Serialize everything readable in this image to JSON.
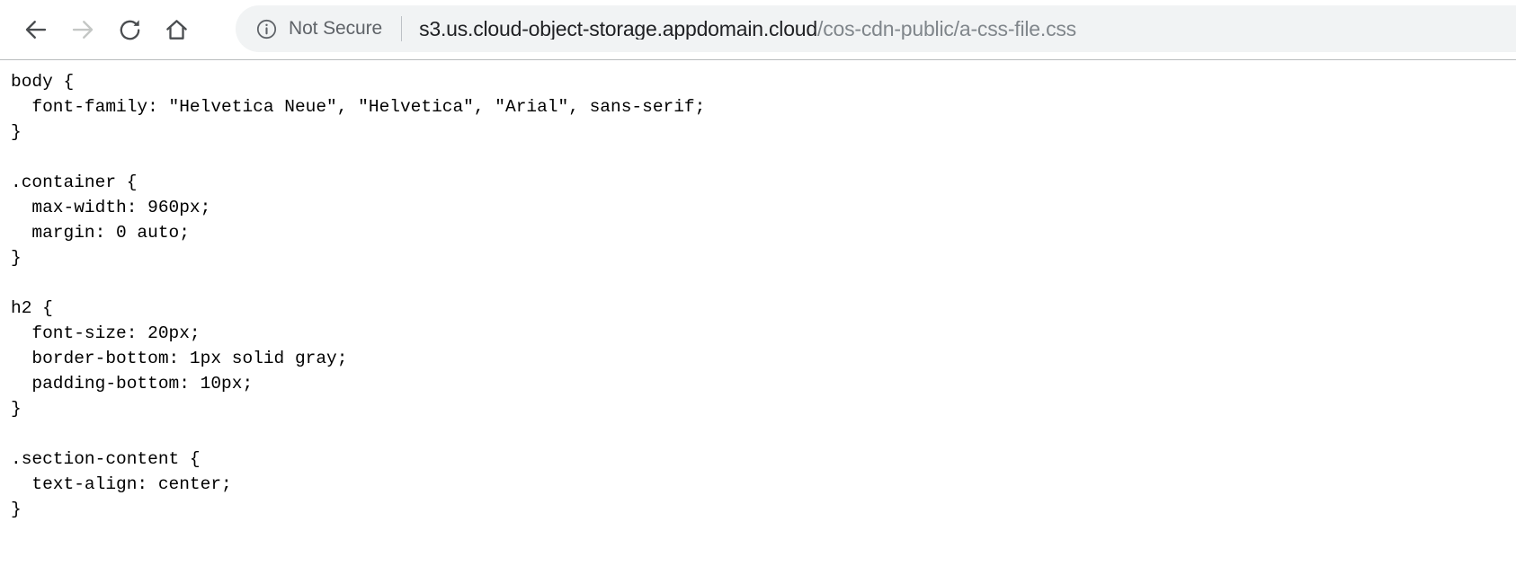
{
  "browser": {
    "nav": {
      "back_label": "Back",
      "back_icon": "arrow-left-icon",
      "forward_label": "Forward",
      "forward_icon": "arrow-right-icon",
      "reload_label": "Reload",
      "reload_icon": "reload-icon",
      "home_label": "Home",
      "home_icon": "home-icon"
    },
    "omnibox": {
      "security_icon": "info-circle-icon",
      "security_text": "Not Secure",
      "url_host": "s3.us.cloud-object-storage.appdomain.cloud",
      "url_path": "/cos-cdn-public/a-css-file.css",
      "full_url": "s3.us.cloud-object-storage.appdomain.cloud/cos-cdn-public/a-css-file.css"
    },
    "colors": {
      "omnibox_background": "#f1f3f4",
      "toolbar_background": "#ffffff",
      "icon_enabled": "#5f6368",
      "icon_disabled": "#c4c7c5",
      "host_text": "#202124",
      "path_text": "#80868b",
      "body_text": "#000000"
    }
  },
  "document": {
    "content_type": "text/css",
    "text": "body {\n  font-family: \"Helvetica Neue\", \"Helvetica\", \"Arial\", sans-serif;\n}\n\n.container {\n  max-width: 960px;\n  margin: 0 auto;\n}\n\nh2 {\n  font-size: 20px;\n  border-bottom: 1px solid gray;\n  padding-bottom: 10px;\n}\n\n.section-content {\n  text-align: center;\n}"
  }
}
